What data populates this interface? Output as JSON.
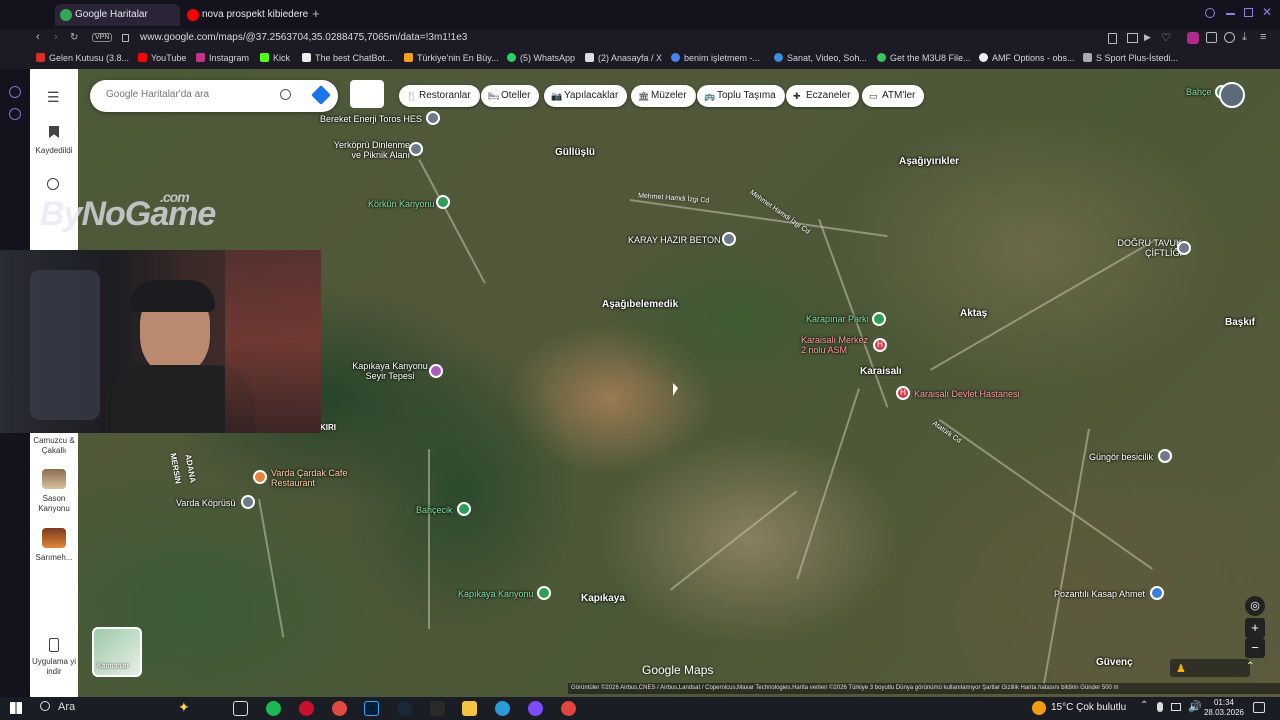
{
  "browser": {
    "tabs": [
      {
        "title": "Google Haritalar",
        "active": true
      },
      {
        "title": "nova prospekt kibiedere",
        "active": false
      }
    ],
    "new_tab": "+",
    "url": "www.google.com/maps/@37.2563704,35.0288475,7065m/data=!3m1!1e3",
    "vpn": "VPN",
    "bookmarks": [
      "Gelen Kutusu (3.8...",
      "YouTube",
      "Instagram",
      "Kick",
      "The best ChatBot...",
      "Türkiye'nin En Büy...",
      "(5) WhatsApp",
      "(2) Anasayfa / X",
      "benim işletmem -...",
      "Sanat, Video, Soh...",
      "Get the M3U8 File...",
      "AMF Options - obs...",
      "S Sport Plus-İstedi..."
    ]
  },
  "maps": {
    "search_placeholder": "Google Haritalar'da ara",
    "chips": [
      "Restoranlar",
      "Oteller",
      "Yapılacaklar",
      "Müzeler",
      "Toplu Taşıma",
      "Eczaneler",
      "ATM'ler"
    ],
    "side": {
      "saved": "Kaydedildi",
      "recent_items": [
        {
          "label": "Camuzcu & Çakallı"
        },
        {
          "label": "Sason Kanyonu"
        },
        {
          "label": "Sarımeh..."
        }
      ],
      "download": "Uygulama yi indir"
    },
    "layers_label": "Katmanlar",
    "watermark": "ByNoGame",
    "watermark_suffix": ".com",
    "places": [
      "Güllüşlü",
      "Aşağıyırıkler",
      "Aşağıbelemedik",
      "Aktaş",
      "Başkıf",
      "Karaisalı",
      "Kapıkaya",
      "Güvenç"
    ],
    "pois": [
      "Bereket Enerji Toros HES",
      "Yerköprü Dinlenme ve Piknik Alanı",
      "Körkün Kanyonu",
      "KARAY HAZIR BETON",
      "Karapınar Parkı",
      "Karaisalı Merkez 2 nolu ASM",
      "Karaisalı Devlet Hastanesi",
      "DOĞRU TAVUK ÇİFTLİĞİ",
      "Kapıkaya Kanyonu Seyir Tepesi",
      "Varda Çardak Cafe Restaurant",
      "Varda Köprüsü",
      "Bahçecik",
      "Kapıkaya Kanyonu",
      "Güngör besicilik",
      "Pozantılı Kasap Ahmet",
      "Bahçe"
    ],
    "road_labels": [
      "Mehmet Hamdi İzgi Cd",
      "Mehmet Hamdi İzgi Cd",
      "MERSİN",
      "ADANA",
      "KIRI",
      "Atatürk Cd"
    ],
    "logo": "Google Maps",
    "attribution": "Görüntüler ©2026 Airbus,CNES / Airbus,Landsat / Copernicus,Maxar Technologies,Harita verileri ©2026   Türkiye   3 boyutlu Dünya görünümü kullanılamıyor   Şartlar   Gizlilik   Harita hatasını bildirin   Günder    500 m"
  },
  "taskbar": {
    "search": "Ara",
    "weather": "15°C  Çok bulutlu",
    "time": "01:34",
    "date": "28.03.2026"
  }
}
